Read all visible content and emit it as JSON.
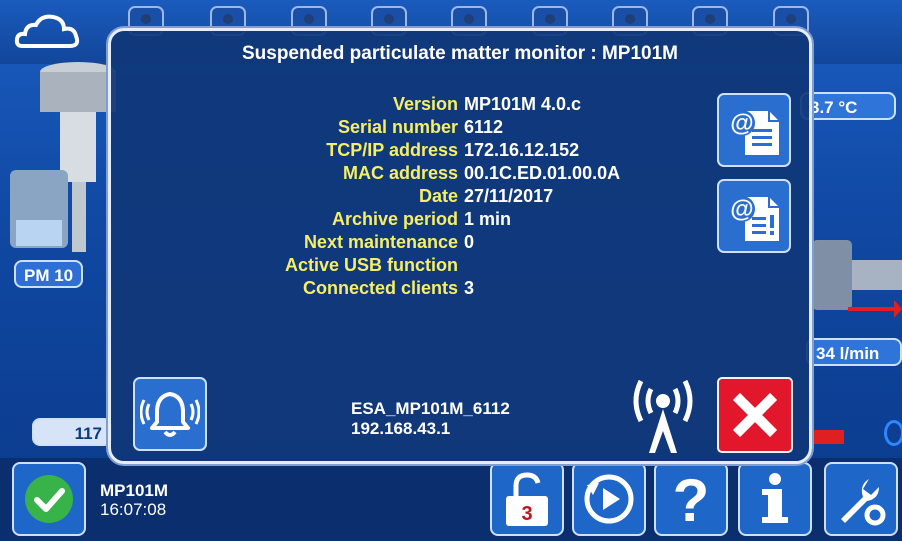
{
  "dialog": {
    "title": "Suspended particulate matter monitor : MP101M",
    "rows": [
      {
        "label": "Version",
        "value": "MP101M 4.0.c"
      },
      {
        "label": "Serial number",
        "value": "6112"
      },
      {
        "label": "TCP/IP address",
        "value": "172.16.12.152"
      },
      {
        "label": "MAC address",
        "value": "00.1C.ED.01.00.0A"
      },
      {
        "label": "Date",
        "value": "27/11/2017"
      },
      {
        "label": "Archive period",
        "value": "1 min"
      },
      {
        "label": "Next maintenance",
        "value": "0"
      },
      {
        "label": "Active USB function",
        "value": ""
      },
      {
        "label": "Connected clients",
        "value": "3"
      }
    ],
    "network_name": "ESA_MP101M_6112",
    "network_ip": "192.168.43.1",
    "icons": {
      "email_report": "email-document-icon",
      "email_alert": "email-alert-document-icon",
      "alarm": "alarm-bell-icon",
      "wireless": "wireless-antenna-icon",
      "close": "close-x-icon"
    },
    "colors": {
      "label": "#f6ee63",
      "close": "#e3172b"
    }
  },
  "background": {
    "pm_label": "PM 10",
    "temperature": "3.7 °C",
    "flow": "34 l/min",
    "counter": "117"
  },
  "status": {
    "device": "MP101M",
    "time": "16:07:08",
    "ok_color": "#37b34a"
  },
  "toolbar": {
    "lock_badge": "3"
  }
}
